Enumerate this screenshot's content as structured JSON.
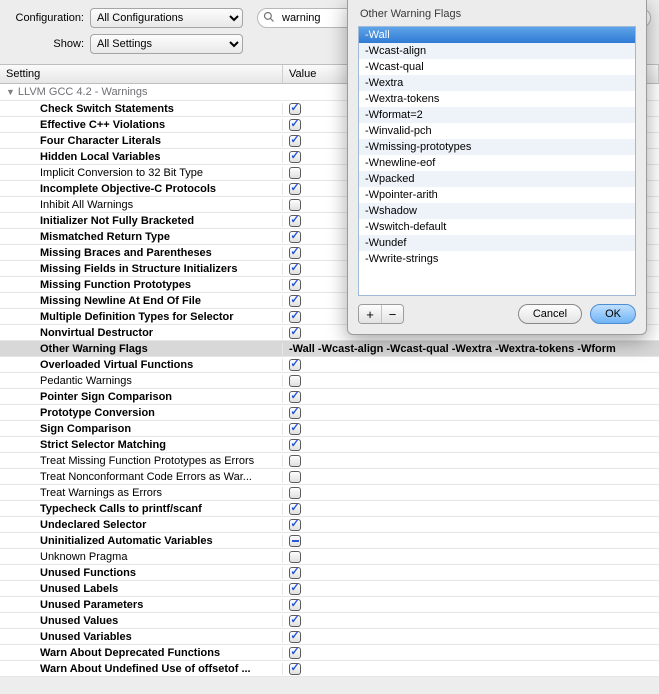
{
  "toolbar": {
    "configuration_label": "Configuration:",
    "configuration_value": "All Configurations",
    "show_label": "Show:",
    "show_value": "All Settings",
    "search_value": "warning"
  },
  "headers": {
    "setting": "Setting",
    "value": "Value"
  },
  "group": "LLVM GCC 4.2 - Warnings",
  "rows": [
    {
      "label": "Check Switch Statements",
      "bold": true,
      "state": "checked"
    },
    {
      "label": "Effective C++ Violations",
      "bold": true,
      "state": "checked"
    },
    {
      "label": "Four Character Literals",
      "bold": true,
      "state": "checked"
    },
    {
      "label": "Hidden Local Variables",
      "bold": true,
      "state": "checked"
    },
    {
      "label": "Implicit Conversion to 32 Bit Type",
      "bold": false,
      "state": "unchecked"
    },
    {
      "label": "Incomplete Objective-C Protocols",
      "bold": true,
      "state": "checked"
    },
    {
      "label": "Inhibit All Warnings",
      "bold": false,
      "state": "unchecked"
    },
    {
      "label": "Initializer Not Fully Bracketed",
      "bold": true,
      "state": "checked"
    },
    {
      "label": "Mismatched Return Type",
      "bold": true,
      "state": "checked"
    },
    {
      "label": "Missing Braces and Parentheses",
      "bold": true,
      "state": "checked"
    },
    {
      "label": "Missing Fields in Structure Initializers",
      "bold": true,
      "state": "checked"
    },
    {
      "label": "Missing Function Prototypes",
      "bold": true,
      "state": "checked"
    },
    {
      "label": "Missing Newline At End Of File",
      "bold": true,
      "state": "checked"
    },
    {
      "label": "Multiple Definition Types for Selector",
      "bold": true,
      "state": "checked"
    },
    {
      "label": "Nonvirtual Destructor",
      "bold": true,
      "state": "checked"
    },
    {
      "label": "Other Warning Flags",
      "bold": true,
      "state": null,
      "selected": true,
      "valueText": "-Wall -Wcast-align -Wcast-qual -Wextra -Wextra-tokens -Wform"
    },
    {
      "label": "Overloaded Virtual Functions",
      "bold": true,
      "state": "checked"
    },
    {
      "label": "Pedantic Warnings",
      "bold": false,
      "state": "unchecked"
    },
    {
      "label": "Pointer Sign Comparison",
      "bold": true,
      "state": "checked"
    },
    {
      "label": "Prototype Conversion",
      "bold": true,
      "state": "checked"
    },
    {
      "label": "Sign Comparison",
      "bold": true,
      "state": "checked"
    },
    {
      "label": "Strict Selector Matching",
      "bold": true,
      "state": "checked"
    },
    {
      "label": "Treat Missing Function Prototypes as Errors",
      "bold": false,
      "state": "unchecked"
    },
    {
      "label": "Treat Nonconformant Code Errors as War...",
      "bold": false,
      "state": "unchecked"
    },
    {
      "label": "Treat Warnings as Errors",
      "bold": false,
      "state": "unchecked"
    },
    {
      "label": "Typecheck Calls to printf/scanf",
      "bold": true,
      "state": "checked"
    },
    {
      "label": "Undeclared Selector",
      "bold": true,
      "state": "checked"
    },
    {
      "label": "Uninitialized Automatic Variables",
      "bold": true,
      "state": "mixed"
    },
    {
      "label": "Unknown Pragma",
      "bold": false,
      "state": "unchecked"
    },
    {
      "label": "Unused Functions",
      "bold": true,
      "state": "checked"
    },
    {
      "label": "Unused Labels",
      "bold": true,
      "state": "checked"
    },
    {
      "label": "Unused Parameters",
      "bold": true,
      "state": "checked"
    },
    {
      "label": "Unused Values",
      "bold": true,
      "state": "checked"
    },
    {
      "label": "Unused Variables",
      "bold": true,
      "state": "checked"
    },
    {
      "label": "Warn About Deprecated Functions",
      "bold": true,
      "state": "checked"
    },
    {
      "label": "Warn About Undefined Use of offsetof ...",
      "bold": true,
      "state": "checked"
    }
  ],
  "popover": {
    "title": "Other Warning Flags",
    "flags": [
      "-Wall",
      "-Wcast-align",
      "-Wcast-qual",
      "-Wextra",
      "-Wextra-tokens",
      "-Wformat=2",
      "-Winvalid-pch",
      "-Wmissing-prototypes",
      "-Wnewline-eof",
      "-Wpacked",
      "-Wpointer-arith",
      "-Wshadow",
      "-Wswitch-default",
      "-Wundef",
      "-Wwrite-strings"
    ],
    "selected_index": 0,
    "add": "+",
    "remove": "−",
    "cancel": "Cancel",
    "ok": "OK"
  }
}
